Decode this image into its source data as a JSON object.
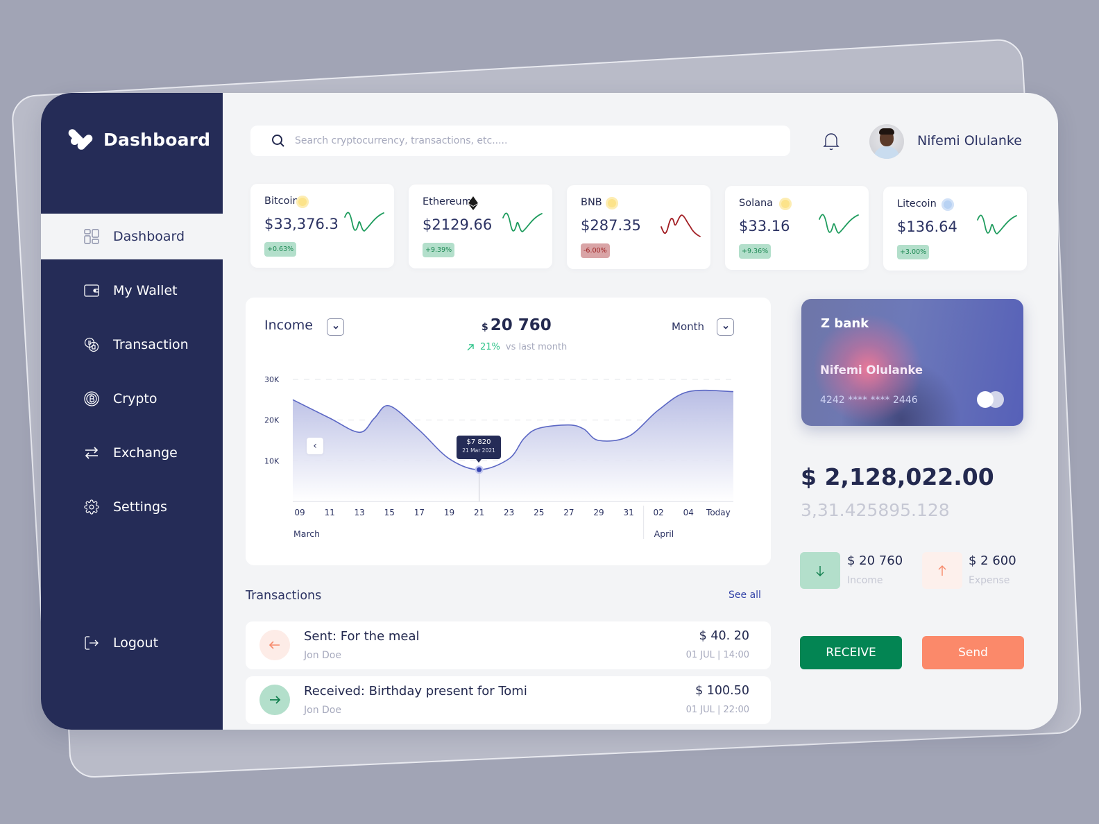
{
  "brand": {
    "title": "Dashboard"
  },
  "sidebar": {
    "items": [
      {
        "label": "Dashboard",
        "icon": "grid-icon",
        "active": true
      },
      {
        "label": "My Wallet",
        "icon": "wallet-icon"
      },
      {
        "label": "Transaction",
        "icon": "transaction-icon"
      },
      {
        "label": "Crypto",
        "icon": "bitcoin-coin-icon"
      },
      {
        "label": "Exchange",
        "icon": "exchange-arrows-icon"
      },
      {
        "label": "Settings",
        "icon": "gear-icon"
      }
    ],
    "logout": {
      "label": "Logout",
      "icon": "logout-icon"
    }
  },
  "header": {
    "search": {
      "placeholder": "Search cryptocurrency, transactions, etc.....",
      "value": ""
    },
    "notifications_icon": "bell-icon",
    "user": {
      "name": "Nifemi Olulanke"
    }
  },
  "coins": [
    {
      "name": "Bitcoin",
      "price": "$33,376.3",
      "change": "+0.63%",
      "trend": "up",
      "color": "#1f9c5e",
      "logo_color": "#fce38a"
    },
    {
      "name": "Ethereum",
      "price": "$2129.66",
      "change": "+9.39%",
      "trend": "up",
      "color": "#1f9c5e",
      "logo_color": "#1a1a1a"
    },
    {
      "name": "BNB",
      "price": "$287.35",
      "change": "-6.00%",
      "trend": "down",
      "color": "#a11d22",
      "logo_color": "#fce38a"
    },
    {
      "name": "Solana",
      "price": "$33.16",
      "change": "+9.36%",
      "trend": "up",
      "color": "#1f9c5e",
      "logo_color": "#fce38a"
    },
    {
      "name": "Litecoin",
      "price": "$136.64",
      "change": "+3.00%",
      "trend": "up",
      "color": "#1f9c5e",
      "logo_color": "#b8d2f3"
    }
  ],
  "income": {
    "title": "Income",
    "total_currency": "$",
    "total": "20 760",
    "change_pct": "21%",
    "change_label": "vs last month",
    "period": "Month",
    "tooltip": {
      "value": "$7 820",
      "date": "21 Mar 2021"
    }
  },
  "chart_data": {
    "type": "area",
    "title": "Income",
    "y_ticks": [
      "30K",
      "20K",
      "10K"
    ],
    "ylim": [
      0,
      30000
    ],
    "x_ticks": [
      "09",
      "11",
      "13",
      "15",
      "17",
      "19",
      "21",
      "23",
      "25",
      "27",
      "29",
      "31",
      "02",
      "04",
      "Today"
    ],
    "month_labels": [
      "March",
      "April"
    ],
    "grid": "dashed horizontal",
    "series": [
      {
        "name": "Income",
        "x": [
          "09",
          "11",
          "13",
          "14",
          "15",
          "17",
          "19",
          "21",
          "23",
          "24",
          "25",
          "27",
          "28",
          "29",
          "31",
          "02",
          "04",
          "Today"
        ],
        "values": [
          25000,
          20500,
          17000,
          20500,
          23500,
          17500,
          10500,
          7820,
          10500,
          15500,
          18000,
          18800,
          17800,
          15000,
          16000,
          22500,
          27000,
          27000
        ]
      }
    ],
    "highlight": {
      "x": "21",
      "value": 7820,
      "label": "21 Mar 2021"
    },
    "line_color": "#5b67c4"
  },
  "transactions": {
    "title": "Transactions",
    "see_all": "See all",
    "items": [
      {
        "type": "sent",
        "title": "Sent: For the meal",
        "party": "Jon Doe",
        "amount": "$ 40. 20",
        "date": "01 JUL | 14:00"
      },
      {
        "type": "received",
        "title": "Received: Birthday present for Tomi",
        "party": "Jon Doe",
        "amount": "$ 100.50",
        "date": "01 JUL | 22:00"
      }
    ]
  },
  "bank_card": {
    "bank": "Z bank",
    "holder": "Nifemi Olulanke",
    "number": "4242 **** **** 2446"
  },
  "balance": {
    "main": "$ 2,128,022.00",
    "secondary": "3,31.425895.128"
  },
  "summary": {
    "income": {
      "value": "$ 20 760",
      "label": "Income"
    },
    "expense": {
      "value": "$ 2 600",
      "label": "Expense"
    }
  },
  "actions": {
    "receive": "RECEIVE",
    "send": "Send"
  },
  "colors": {
    "navy": "#252c57",
    "green": "#038553",
    "coral": "#fb896a",
    "chart": "#5b67c4"
  }
}
